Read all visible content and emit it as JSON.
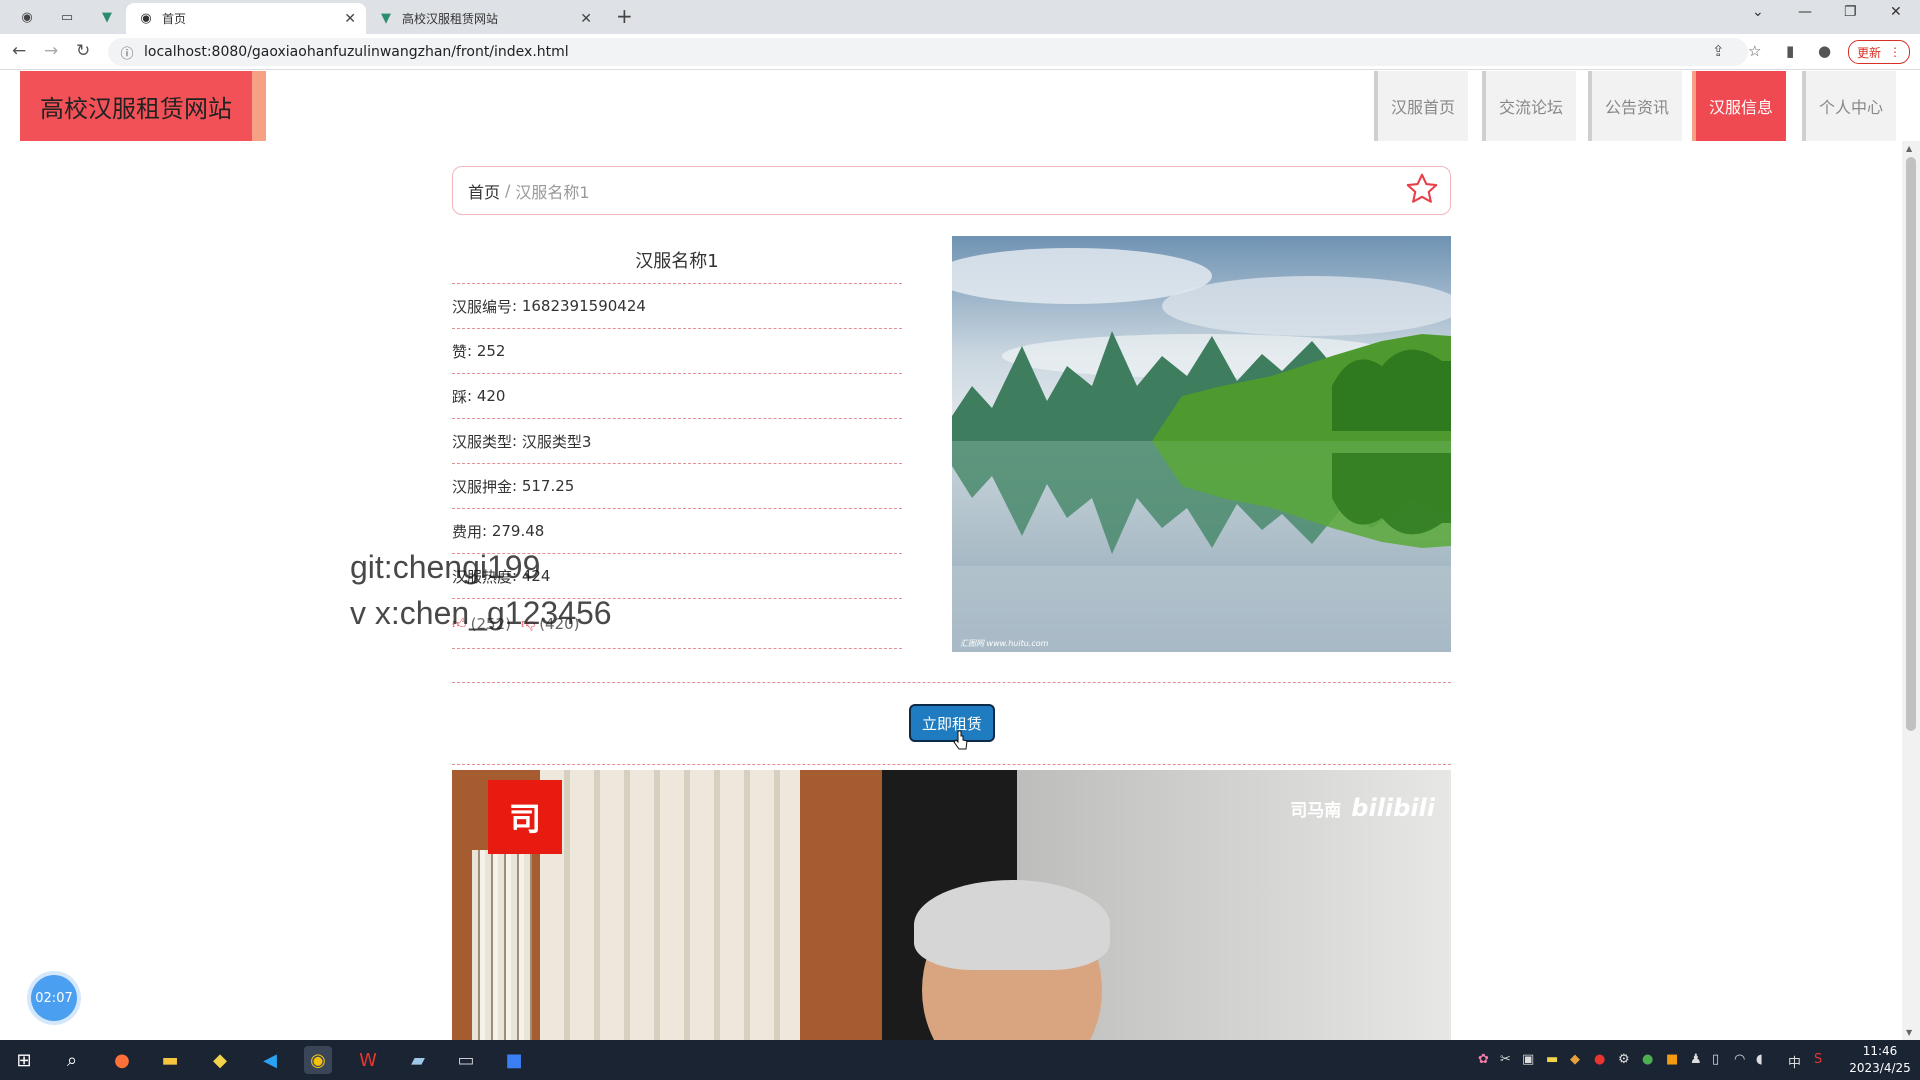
{
  "browser": {
    "tabs": [
      {
        "label": "首页",
        "icon": "globe-icon"
      },
      {
        "label": "高校汉服租赁网站",
        "icon": "vue-icon"
      }
    ],
    "url": "localhost:8080/gaoxiaohanfuzulinwangzhan/front/index.html",
    "update_label": "更新"
  },
  "site": {
    "title": "高校汉服租赁网站",
    "nav": [
      {
        "label": "汉服首页",
        "active": false
      },
      {
        "label": "交流论坛",
        "active": false
      },
      {
        "label": "公告资讯",
        "active": false
      },
      {
        "label": "汉服信息",
        "active": true
      },
      {
        "label": "个人中心",
        "active": false
      }
    ],
    "accent_color": "#ef4a52"
  },
  "breadcrumb": {
    "home": "首页",
    "separator": "/",
    "current": "汉服名称1"
  },
  "detail": {
    "name": "汉服名称1",
    "rows": [
      {
        "label": "汉服编号",
        "value": "1682391590424"
      },
      {
        "label": "赞",
        "value": "252"
      },
      {
        "label": "踩",
        "value": "420"
      },
      {
        "label": "汉服类型",
        "value": "汉服类型3"
      },
      {
        "label": "汉服押金",
        "value": "517.25"
      },
      {
        "label": "费用",
        "value": "279.48"
      },
      {
        "label": "汉服热度",
        "value": "424"
      }
    ],
    "thumbs_up_count": "(252)",
    "thumbs_down_count": "(420)",
    "image_watermark": "汇图网 www.huitu.com"
  },
  "actions": {
    "rent_label": "立即租赁"
  },
  "video": {
    "logo_char": "司",
    "uploader": "司马南",
    "brand": "bilibili"
  },
  "overlay": {
    "watermark_line1": "git:chengi199",
    "watermark_line2": "v x:chen_g123456",
    "timer": "02:07"
  },
  "taskbar": {
    "time": "11:46",
    "date": "2023/4/25",
    "ime": "中"
  }
}
